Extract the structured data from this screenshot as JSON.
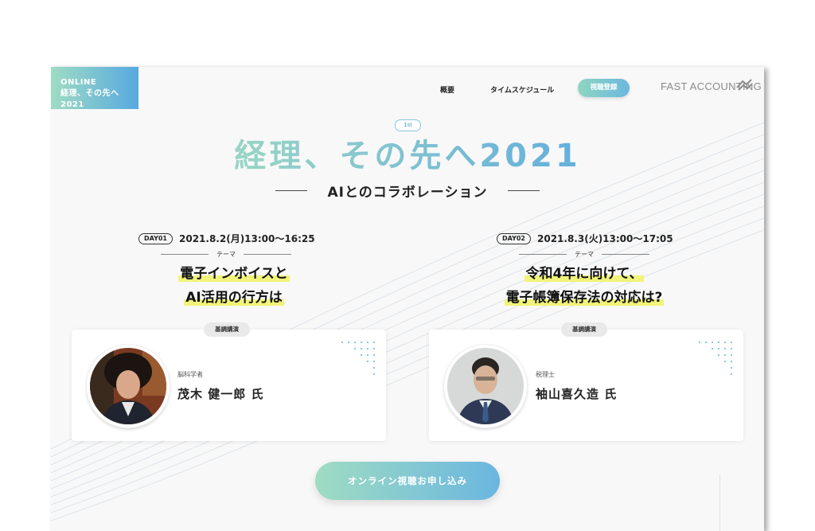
{
  "header": {
    "badge_line1": "ONLINE",
    "badge_line2": "経理、その先へ2021",
    "nav": {
      "overview": "概要",
      "schedule": "タイムスケジュール",
      "register": "視聴登録"
    },
    "brand": "FAST ACCOUNTING"
  },
  "hero": {
    "edition": "1st",
    "title": "経理、その先へ2021",
    "subtitle": "AIとのコラボレーション"
  },
  "days": [
    {
      "tag": "DAY01",
      "date": "2021.8.2(月)13:00〜16:25",
      "theme_label": "テーマ",
      "topic_line1": "電子インボイスと",
      "topic_line2": "AI活用の行方は",
      "keynote_label": "基調講演",
      "speaker_role": "脳科学者",
      "speaker_name": "茂木 健一郎 氏"
    },
    {
      "tag": "DAY02",
      "date": "2021.8.3(火)13:00〜17:05",
      "theme_label": "テーマ",
      "topic_line1": "令和4年に向けて、",
      "topic_line2": "電子帳簿保存法の対応は?",
      "keynote_label": "基調講演",
      "speaker_role": "税理士",
      "speaker_name": "袖山喜久造 氏"
    }
  ],
  "cta": {
    "apply_label": "オンライン視聴お申し込み"
  },
  "colors": {
    "gradient_start": "#9fdcc3",
    "gradient_end": "#56a9e0",
    "highlight": "#f1f37a",
    "page_bg": "#f8f8f8"
  }
}
